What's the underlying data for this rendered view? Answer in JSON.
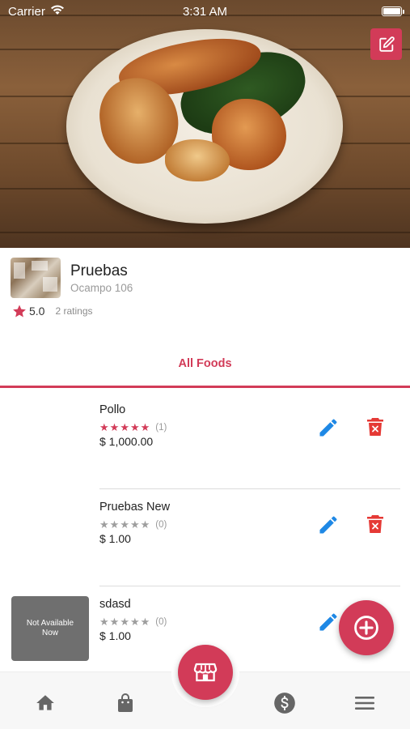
{
  "status_bar": {
    "carrier": "Carrier",
    "time": "3:31 AM"
  },
  "colors": {
    "accent": "#d23b58",
    "edit_blue": "#1e88e5",
    "delete_red": "#e53935",
    "star_active": "#d23b58",
    "star_inactive": "#9e9e9e"
  },
  "store": {
    "name": "Pruebas",
    "address": "Ocampo 106",
    "rating": "5.0",
    "ratings_count": "2 ratings"
  },
  "tabs": [
    {
      "label": "All Foods",
      "active": true
    }
  ],
  "foods": [
    {
      "name": "Pollo",
      "stars_filled": 5,
      "rating_count": "(1)",
      "price": "$ 1,000.00",
      "thumbnail": "blank"
    },
    {
      "name": "Pruebas New",
      "stars_filled": 0,
      "rating_count": "(0)",
      "price": "$ 1.00",
      "thumbnail": "blank"
    },
    {
      "name": "sdasd",
      "stars_filled": 0,
      "rating_count": "(0)",
      "price": "$ 1.00",
      "thumbnail": "unavailable",
      "thumbnail_label": "Not Available Now"
    }
  ],
  "icons": {
    "header_edit": "edit-square-icon",
    "row_edit": "pencil-icon",
    "row_delete": "trash-icon",
    "fab_add": "plus-circle-icon",
    "fab_store": "storefront-icon",
    "nav": [
      "home-icon",
      "shopping-bag-icon",
      "dollar-icon",
      "menu-icon"
    ]
  }
}
